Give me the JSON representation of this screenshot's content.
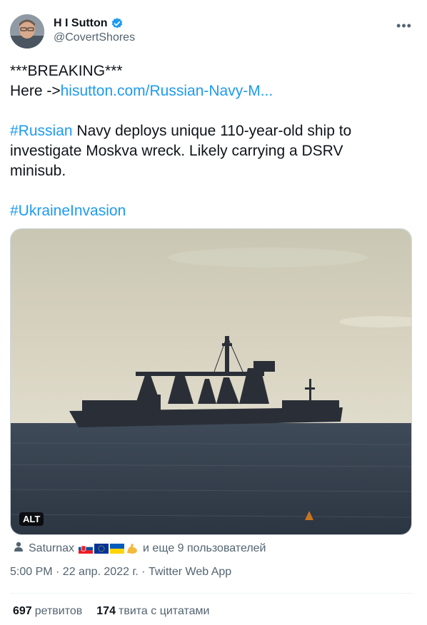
{
  "author": {
    "name": "H I Sutton",
    "handle": "@CovertShores"
  },
  "tweet": {
    "line1": "***BREAKING***",
    "line2_prefix": "Here ->",
    "line2_link": "hisutton.com/Russian-Navy-M...",
    "p2_hashtag": "#Russian",
    "p2_text_1": " Navy deploys unique 110-year-old ship to",
    "p2_text_2": "investigate Moskva wreck. Likely carrying a DSRV",
    "p2_text_3": "minisub.",
    "p3_hashtag": "#UkraineInvasion"
  },
  "media": {
    "alt_label": "ALT"
  },
  "social_context": {
    "user": "Saturnax",
    "suffix": "и еще 9 пользователей",
    "emoji": [
      "slovakia-flag",
      "eu-flag",
      "ukraine-flag",
      "flexed-biceps"
    ]
  },
  "meta": {
    "text": "5:00 PM · 22 апр. 2022 г. · Twitter Web App"
  },
  "stats": {
    "retweets_count": "697",
    "retweets_label": "ретвитов",
    "quotes_count": "174",
    "quotes_label": "твита с цитатами"
  },
  "colors": {
    "link": "#1d9bf0",
    "verified": "#1d9bf0",
    "secondary_text": "#536471"
  }
}
